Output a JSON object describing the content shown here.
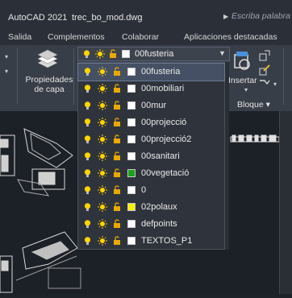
{
  "titlebar": {
    "app": "AutoCAD 2021",
    "file": "trec_bo_mod.dwg",
    "search_placeholder": "Escriba palabra c"
  },
  "menu": [
    "Salida",
    "Complementos",
    "Colaborar",
    "Aplicaciones destacadas"
  ],
  "ribbon": {
    "properties_label": "Propiedades\nde capa",
    "insert_label": "Insertar",
    "block_label": "Bloque ▾"
  },
  "layers": {
    "current": "00fusteria",
    "items": [
      {
        "name": "00fusteria",
        "color": "#ffffff",
        "selected": true
      },
      {
        "name": "00mobiliari",
        "color": "#ffffff"
      },
      {
        "name": "00mur",
        "color": "#ffffff"
      },
      {
        "name": "00projecció",
        "color": "#ffffff"
      },
      {
        "name": "00projecció2",
        "color": "#ffffff"
      },
      {
        "name": "00sanitari",
        "color": "#ffffff"
      },
      {
        "name": "00vegetació",
        "color": "#1aa01a"
      },
      {
        "name": "0",
        "color": "#ffffff"
      },
      {
        "name": "02polaux",
        "color": "#f7f300"
      },
      {
        "name": "defpoints",
        "color": "#ffffff"
      },
      {
        "name": "TEXTOS_P1",
        "color": "#ffffff"
      }
    ]
  },
  "colors": {
    "bulb": "#ffd400",
    "sun": "#ffd400",
    "lock": "#e8a900"
  }
}
